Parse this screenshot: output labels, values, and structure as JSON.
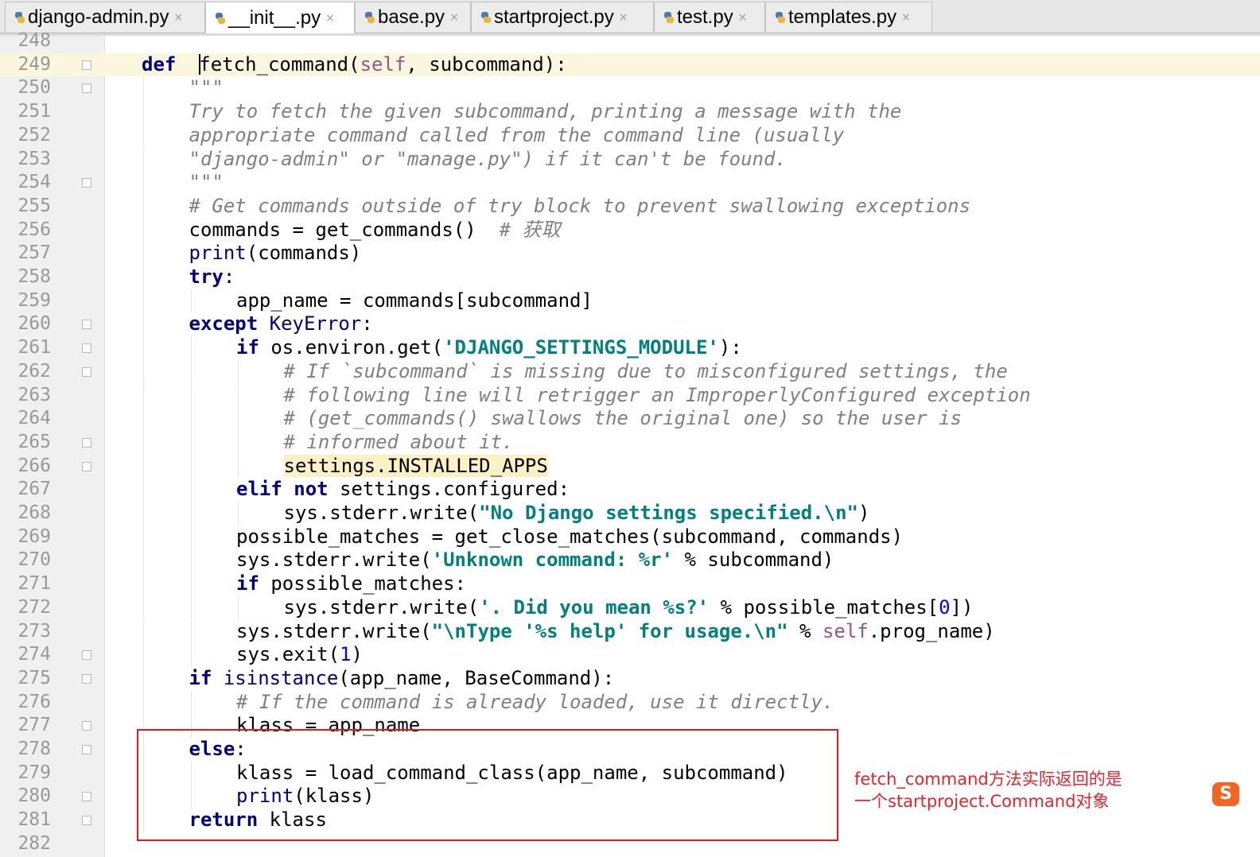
{
  "tabs": [
    {
      "label": "django-admin.py",
      "active": false
    },
    {
      "label": "__init__.py",
      "active": true
    },
    {
      "label": "base.py",
      "active": false
    },
    {
      "label": "startproject.py",
      "active": false
    },
    {
      "label": "test.py",
      "active": false
    },
    {
      "label": "templates.py",
      "active": false
    }
  ],
  "editor": {
    "current_line": "249",
    "lines": [
      {
        "n": "248",
        "indent": 0,
        "fold": false,
        "parts": []
      },
      {
        "n": "249",
        "indent": 1,
        "fold": true,
        "parts": [
          [
            "kw",
            "def"
          ],
          [
            "",
            "  "
          ],
          [
            "caret",
            ""
          ],
          [
            "",
            "fetch_command("
          ],
          [
            "slf",
            "self"
          ],
          [
            "",
            ", subcommand):"
          ]
        ]
      },
      {
        "n": "250",
        "indent": 2,
        "fold": true,
        "parts": [
          [
            "cm",
            "\"\"\""
          ]
        ]
      },
      {
        "n": "251",
        "indent": 2,
        "fold": false,
        "parts": [
          [
            "cm",
            "Try to fetch the given subcommand, printing a message with the"
          ]
        ]
      },
      {
        "n": "252",
        "indent": 2,
        "fold": false,
        "parts": [
          [
            "cm",
            "appropriate command called from the command line (usually"
          ]
        ]
      },
      {
        "n": "253",
        "indent": 2,
        "fold": false,
        "parts": [
          [
            "cm",
            "\"django-admin\" or \"manage.py\") if it can't be found."
          ]
        ]
      },
      {
        "n": "254",
        "indent": 2,
        "fold": true,
        "parts": [
          [
            "cm",
            "\"\"\""
          ]
        ]
      },
      {
        "n": "255",
        "indent": 2,
        "fold": false,
        "parts": [
          [
            "cm",
            "# Get commands outside of try block to prevent swallowing exceptions"
          ]
        ]
      },
      {
        "n": "256",
        "indent": 2,
        "fold": false,
        "parts": [
          [
            "",
            "commands = get_commands()  "
          ],
          [
            "cm",
            "# 获取"
          ]
        ]
      },
      {
        "n": "257",
        "indent": 2,
        "fold": false,
        "parts": [
          [
            "bi",
            "print"
          ],
          [
            "",
            "(commands)"
          ]
        ]
      },
      {
        "n": "258",
        "indent": 2,
        "fold": false,
        "parts": [
          [
            "kw",
            "try"
          ],
          [
            "",
            ":"
          ]
        ]
      },
      {
        "n": "259",
        "indent": 3,
        "fold": false,
        "parts": [
          [
            "",
            "app_name = commands[subcommand]"
          ]
        ]
      },
      {
        "n": "260",
        "indent": 2,
        "fold": true,
        "parts": [
          [
            "kw",
            "except"
          ],
          [
            "",
            " "
          ],
          [
            "bi",
            "KeyError"
          ],
          [
            "",
            ":"
          ]
        ]
      },
      {
        "n": "261",
        "indent": 3,
        "fold": true,
        "parts": [
          [
            "kw",
            "if"
          ],
          [
            "",
            " os.environ.get("
          ],
          [
            "str",
            "'DJANGO_SETTINGS_MODULE'"
          ],
          [
            "",
            "):"
          ]
        ]
      },
      {
        "n": "262",
        "indent": 4,
        "fold": true,
        "parts": [
          [
            "cm",
            "# If `subcommand` is missing due to misconfigured settings, the"
          ]
        ]
      },
      {
        "n": "263",
        "indent": 4,
        "fold": false,
        "parts": [
          [
            "cm",
            "# following line will retrigger an ImproperlyConfigured exception"
          ]
        ]
      },
      {
        "n": "264",
        "indent": 4,
        "fold": false,
        "parts": [
          [
            "cm",
            "# (get_commands() swallows the original one) so the user is"
          ]
        ]
      },
      {
        "n": "265",
        "indent": 4,
        "fold": true,
        "parts": [
          [
            "cm",
            "# informed about it."
          ]
        ]
      },
      {
        "n": "266",
        "indent": 4,
        "fold": true,
        "parts": [
          [
            "hl",
            "settings.INSTALLED_APPS"
          ]
        ]
      },
      {
        "n": "267",
        "indent": 3,
        "fold": false,
        "parts": [
          [
            "kw",
            "elif not"
          ],
          [
            "",
            " settings.configured:"
          ]
        ]
      },
      {
        "n": "268",
        "indent": 4,
        "fold": false,
        "parts": [
          [
            "",
            "sys.stderr.write("
          ],
          [
            "str",
            "\"No Django settings specified.\\n\""
          ],
          [
            "",
            ")"
          ]
        ]
      },
      {
        "n": "269",
        "indent": 3,
        "fold": false,
        "parts": [
          [
            "",
            "possible_matches = get_close_matches(subcommand, commands)"
          ]
        ]
      },
      {
        "n": "270",
        "indent": 3,
        "fold": false,
        "parts": [
          [
            "",
            "sys.stderr.write("
          ],
          [
            "str",
            "'Unknown command: %r'"
          ],
          [
            "",
            " % subcommand)"
          ]
        ]
      },
      {
        "n": "271",
        "indent": 3,
        "fold": false,
        "parts": [
          [
            "kw",
            "if"
          ],
          [
            "",
            " possible_matches:"
          ]
        ]
      },
      {
        "n": "272",
        "indent": 4,
        "fold": false,
        "parts": [
          [
            "",
            "sys.stderr.write("
          ],
          [
            "str",
            "'. Did you mean %s?'"
          ],
          [
            "",
            " % possible_matches["
          ],
          [
            "num",
            "0"
          ],
          [
            "",
            "])"
          ]
        ]
      },
      {
        "n": "273",
        "indent": 3,
        "fold": false,
        "parts": [
          [
            "",
            "sys.stderr.write("
          ],
          [
            "str",
            "\"\\nType '%s help' for usage.\\n\""
          ],
          [
            "",
            " % "
          ],
          [
            "slf",
            "self"
          ],
          [
            "",
            ".prog_name)"
          ]
        ]
      },
      {
        "n": "274",
        "indent": 3,
        "fold": true,
        "parts": [
          [
            "",
            "sys.exit("
          ],
          [
            "num",
            "1"
          ],
          [
            "",
            ")"
          ]
        ]
      },
      {
        "n": "275",
        "indent": 2,
        "fold": true,
        "parts": [
          [
            "kw",
            "if"
          ],
          [
            "",
            " "
          ],
          [
            "bi",
            "isinstance"
          ],
          [
            "",
            "(app_name, BaseCommand):"
          ]
        ]
      },
      {
        "n": "276",
        "indent": 3,
        "fold": false,
        "parts": [
          [
            "cm",
            "# If the command is already loaded, use it directly."
          ]
        ]
      },
      {
        "n": "277",
        "indent": 3,
        "fold": true,
        "parts": [
          [
            "",
            "klass = app_name"
          ]
        ]
      },
      {
        "n": "278",
        "indent": 2,
        "fold": true,
        "parts": [
          [
            "kw",
            "else"
          ],
          [
            "",
            ":"
          ]
        ]
      },
      {
        "n": "279",
        "indent": 3,
        "fold": false,
        "parts": [
          [
            "",
            "klass = load_command_class(app_name, subcommand)"
          ]
        ]
      },
      {
        "n": "280",
        "indent": 3,
        "fold": true,
        "parts": [
          [
            "bi",
            "print"
          ],
          [
            "",
            "(klass)"
          ]
        ]
      },
      {
        "n": "281",
        "indent": 2,
        "fold": true,
        "parts": [
          [
            "kw",
            "return"
          ],
          [
            "",
            " klass"
          ]
        ]
      },
      {
        "n": "282",
        "indent": 0,
        "fold": false,
        "parts": []
      }
    ]
  },
  "annotation": {
    "line1": "fetch_command方法实际返回的是",
    "line2": "一个startproject.Command对象",
    "box_color": "#e61919"
  },
  "tray": {
    "ime_label": "S"
  }
}
